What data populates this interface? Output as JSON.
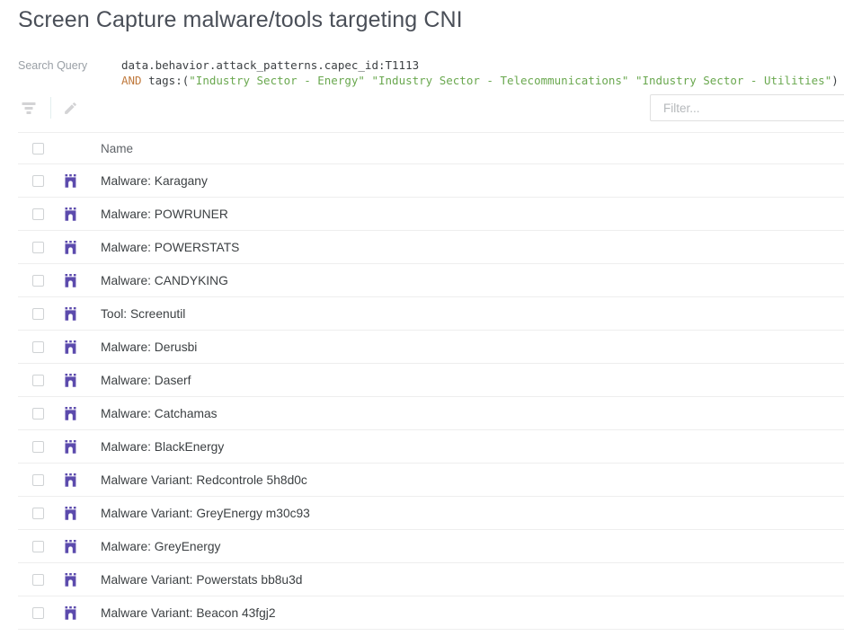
{
  "page": {
    "title": "Screen Capture malware/tools targeting CNI"
  },
  "query": {
    "label": "Search Query",
    "line1_field": "data.behavior.attack_patterns.capec_id:T1113",
    "line2_op": "AND",
    "line2_key": " tags:(",
    "line2_tag1": "\"Industry Sector - Energy\"",
    "line2_sep1": " ",
    "line2_tag2": "\"Industry Sector - Telecommunications\"",
    "line2_sep2": " ",
    "line2_tag3": "\"Industry Sector - Utilities\"",
    "line2_close": ")"
  },
  "toolbar": {
    "filter_icon_name": "filter-icon",
    "edit_icon_name": "pencil-icon"
  },
  "filter": {
    "placeholder": "Filter...",
    "value": ""
  },
  "table": {
    "columns": [
      "Name"
    ],
    "rows": [
      {
        "name": "Malware: Karagany",
        "icon": "malware-castle-icon"
      },
      {
        "name": "Malware: POWRUNER",
        "icon": "malware-castle-icon"
      },
      {
        "name": "Malware: POWERSTATS",
        "icon": "malware-castle-icon"
      },
      {
        "name": "Malware: CANDYKING",
        "icon": "malware-castle-icon"
      },
      {
        "name": "Tool: Screenutil",
        "icon": "malware-castle-icon"
      },
      {
        "name": "Malware: Derusbi",
        "icon": "malware-castle-icon"
      },
      {
        "name": "Malware: Daserf",
        "icon": "malware-castle-icon"
      },
      {
        "name": "Malware: Catchamas",
        "icon": "malware-castle-icon"
      },
      {
        "name": "Malware: BlackEnergy",
        "icon": "malware-castle-icon"
      },
      {
        "name": "Malware Variant: Redcontrole 5h8d0c",
        "icon": "malware-castle-icon"
      },
      {
        "name": "Malware Variant: GreyEnergy m30c93",
        "icon": "malware-castle-icon"
      },
      {
        "name": "Malware: GreyEnergy",
        "icon": "malware-castle-icon"
      },
      {
        "name": "Malware Variant: Powerstats bb8u3d",
        "icon": "malware-castle-icon"
      },
      {
        "name": "Malware Variant: Beacon 43fgj2",
        "icon": "malware-castle-icon"
      }
    ]
  },
  "colors": {
    "malware_icon": "#5c4bad",
    "query_string": "#6aa84f",
    "query_operator": "#c07a3e",
    "title_text": "#4a4f58",
    "row_border": "#eeeeee"
  }
}
